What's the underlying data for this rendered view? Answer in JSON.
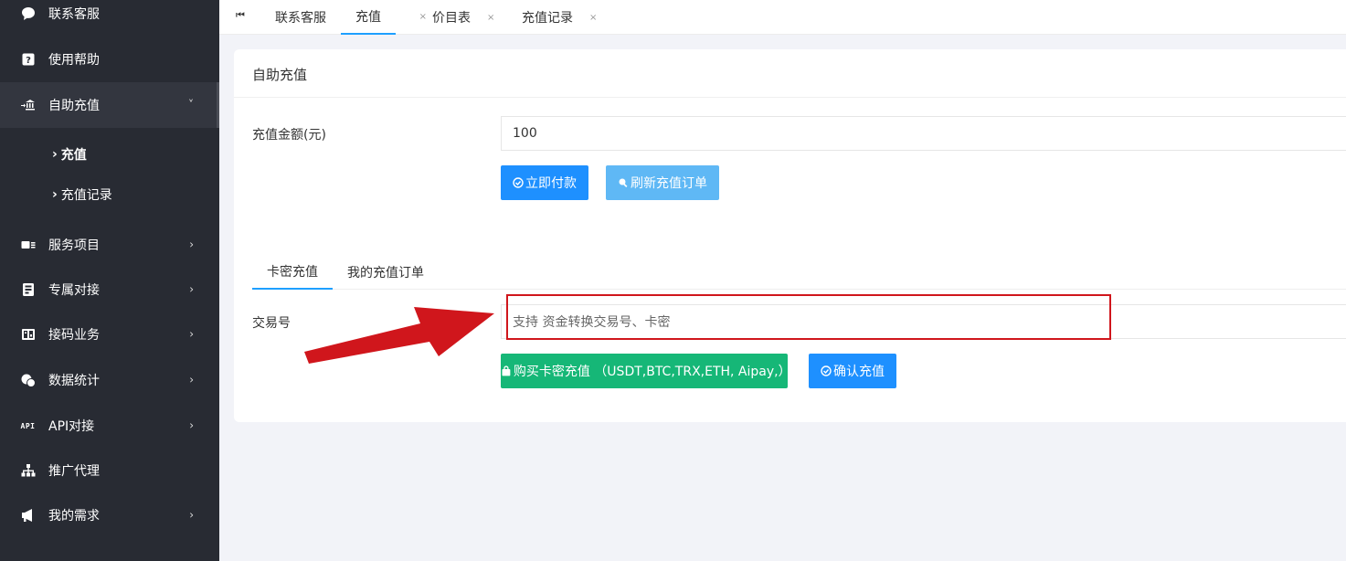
{
  "sidebar": {
    "items": [
      {
        "label": "联系客服",
        "icon": "chat-bubble-icon"
      },
      {
        "label": "使用帮助",
        "icon": "help-question-icon"
      },
      {
        "label": "自助充值",
        "icon": "bank-transfer-icon"
      },
      {
        "label": "服务项目",
        "icon": "id-card-icon"
      },
      {
        "label": "专属对接",
        "icon": "phone-book-icon"
      },
      {
        "label": "接码业务",
        "icon": "sms-code-icon"
      },
      {
        "label": "数据统计",
        "icon": "chart-coins-icon"
      },
      {
        "label": "API对接",
        "icon": "api-icon",
        "badge": "API"
      },
      {
        "label": "推广代理",
        "icon": "hierarchy-icon"
      },
      {
        "label": "我的需求",
        "icon": "megaphone-icon"
      }
    ],
    "subitems": [
      {
        "label": "充值"
      },
      {
        "label": "充值记录"
      }
    ]
  },
  "topbar": {
    "home_icon": "first-page-icon",
    "tabs": [
      {
        "label": "联系客服"
      },
      {
        "label": "充值",
        "close": "×"
      },
      {
        "label": "价目表",
        "close": "×"
      },
      {
        "label": "充值记录",
        "close": "×"
      }
    ]
  },
  "card": {
    "title": "自助充值",
    "amount_label": "充值金额(元)",
    "amount_value": "100",
    "pay_button": "立即付款",
    "refresh_button": "刷新充值订单",
    "subtabs": [
      "卡密充值",
      "我的充值订单"
    ],
    "txn_label": "交易号",
    "txn_placeholder": "支持 资金转换交易号、卡密",
    "buy_card_button": "购买卡密充值 （USDT,BTC,TRX,ETH, Aipay,）",
    "confirm_button": "确认充值"
  },
  "colors": {
    "sidebar_bg": "#282b33",
    "primary_blue": "#1e90ff",
    "light_blue": "#5fb8f5",
    "green": "#16b777",
    "annotation_red": "#d0161c"
  }
}
